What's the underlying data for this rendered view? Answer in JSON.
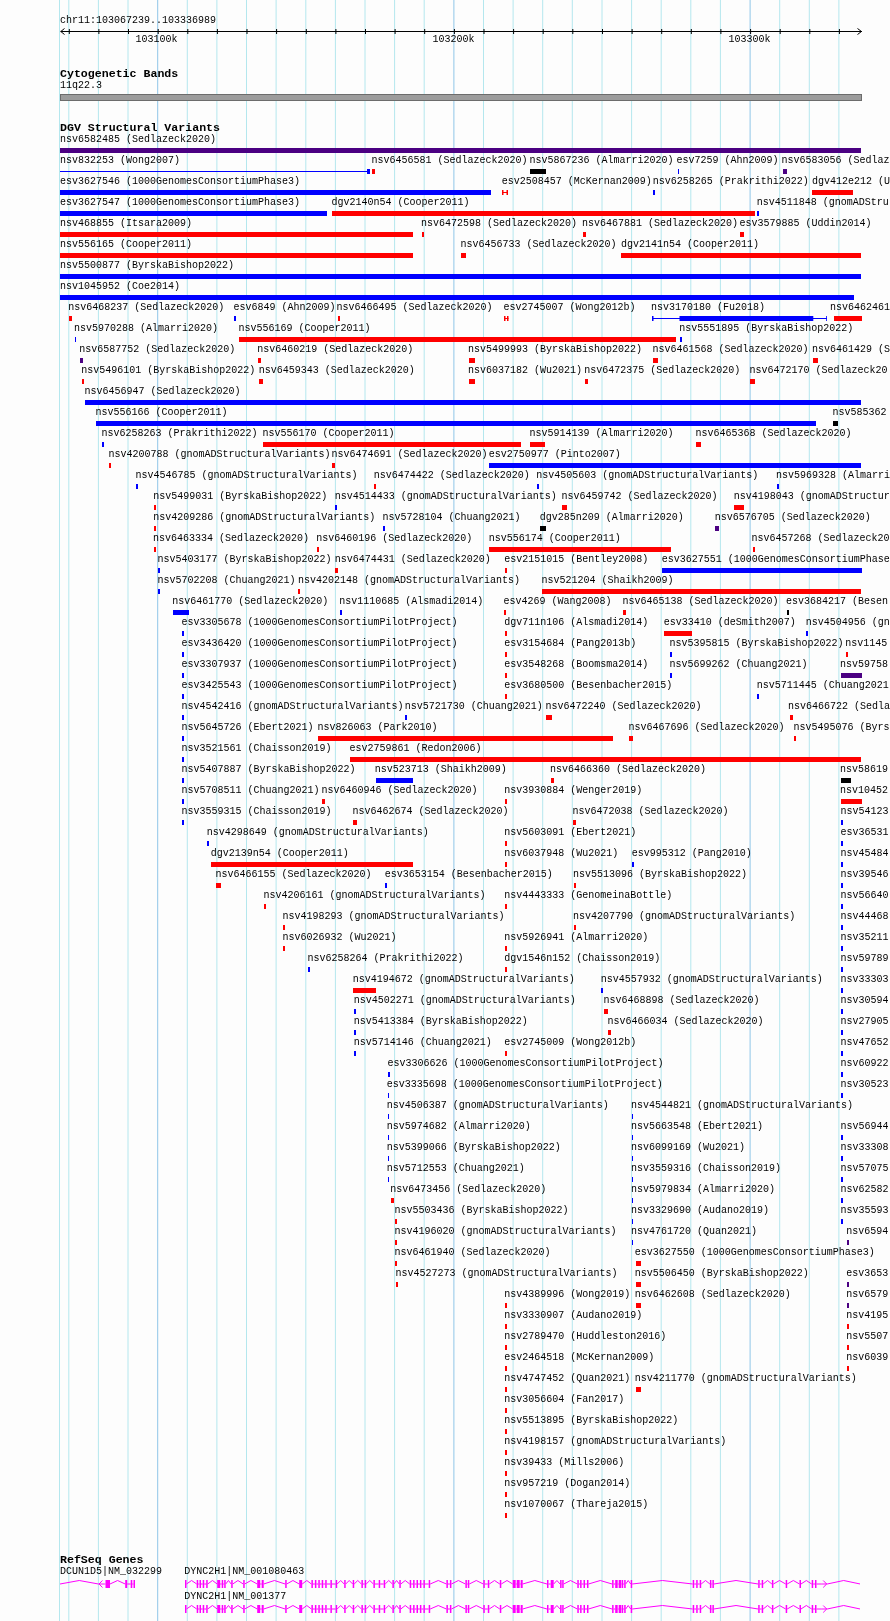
{
  "ruler": {
    "location": "chr11:103067239..103336989",
    "ticks": [
      "103100k",
      "103200k",
      "103300k"
    ]
  },
  "tracks": [
    {
      "kind": "cytoband",
      "title": "Cytogenetic Bands",
      "band": "11q22.3"
    },
    {
      "kind": "variants",
      "title": "DGV Structural Variants",
      "rows": [
        {
          "features": [
            {
              "label": "nsv6582485 (Sedlazeck2020)",
              "color": "#4b0082"
            }
          ]
        },
        {
          "features": [
            {
              "label": "nsv832253 (Wong2007)",
              "color": "#0000ff"
            },
            {
              "label": "nsv6456581 (Sedlazeck2020)",
              "color": "#ff0000"
            },
            {
              "label": "nsv5867236 (Almarri2020)",
              "color": "#000000"
            },
            {
              "label": "esv7259 (Ahn2009)",
              "color": "#0000ff"
            },
            {
              "label": "nsv6583056 (Sedlaz",
              "color": "#4b0082"
            }
          ]
        },
        {
          "features": [
            {
              "label": "esv3627546 (1000GenomesConsortiumPhase3)",
              "color": "#0000ff"
            },
            {
              "label": "esv2508457 (McKernan2009)",
              "color": "#ff0000"
            },
            {
              "label": "nsv6258265 (Prakrithi2022)",
              "color": "#0000ff"
            },
            {
              "label": "dgv412e212 (U",
              "color": "#ff0000"
            }
          ]
        },
        {
          "features": [
            {
              "label": "esv3627547 (1000GenomesConsortiumPhase3)",
              "color": "#0000ff"
            },
            {
              "label": "dgv2140n54 (Cooper2011)",
              "color": "#ff0000"
            },
            {
              "label": "nsv4511848 (gnomADStru",
              "color": "#0000ff"
            }
          ]
        },
        {
          "features": [
            {
              "label": "nsv468855 (Itsara2009)",
              "color": "#ff0000"
            },
            {
              "label": "nsv6472598 (Sedlazeck2020)",
              "color": "#ff0000"
            },
            {
              "label": "nsv6467881 (Sedlazeck2020)",
              "color": "#ff0000"
            },
            {
              "label": "esv3579885 (Uddin2014)",
              "color": "#ff0000"
            }
          ]
        },
        {
          "features": [
            {
              "label": "nsv556165 (Cooper2011)",
              "color": "#ff0000"
            },
            {
              "label": "nsv6456733 (Sedlazeck2020)",
              "color": "#ff0000"
            },
            {
              "label": "dgv2141n54 (Cooper2011)",
              "color": "#ff0000"
            }
          ]
        },
        {
          "features": [
            {
              "label": "nsv5500877 (ByrskaBishop2022)",
              "color": "#0000ff"
            }
          ]
        },
        {
          "features": [
            {
              "label": "nsv1045952 (Coe2014)",
              "color": "#0000ff"
            }
          ]
        },
        {
          "features": [
            {
              "label": "nsv6468237 (Sedlazeck2020)",
              "color": "#ff0000"
            },
            {
              "label": "esv6849 (Ahn2009)",
              "color": "#0000ff"
            },
            {
              "label": "nsv6466495 (Sedlazeck2020)",
              "color": "#ff0000"
            },
            {
              "label": "esv2745007 (Wong2012b)",
              "color": "#ff0000"
            },
            {
              "label": "nsv3170180 (Fu2018)",
              "color": "#0000ff"
            },
            {
              "label": "nsv6462461",
              "color": "#ff0000"
            }
          ]
        },
        {
          "features": [
            {
              "label": "nsv5970288 (Almarri2020)",
              "color": "#0000ff"
            },
            {
              "label": "nsv556169 (Cooper2011)",
              "color": "#ff0000"
            },
            {
              "label": "nsv5551895 (ByrskaBishop2022)",
              "color": "#0000ff"
            }
          ]
        },
        {
          "features": [
            {
              "label": "nsv6587752 (Sedlazeck2020)",
              "color": "#4b0082"
            },
            {
              "label": "nsv6460219 (Sedlazeck2020)",
              "color": "#ff0000"
            },
            {
              "label": "nsv5499993 (ByrskaBishop2022)",
              "color": "#ff0000"
            },
            {
              "label": "nsv6461568 (Sedlazeck2020)",
              "color": "#ff0000"
            },
            {
              "label": "nsv6461429 (S",
              "color": "#ff0000"
            }
          ]
        },
        {
          "features": [
            {
              "label": "nsv5496101 (ByrskaBishop2022)",
              "color": "#ff0000"
            },
            {
              "label": "nsv6459343 (Sedlazeck2020)",
              "color": "#ff0000"
            },
            {
              "label": "nsv6037182 (Wu2021)",
              "color": "#ff0000"
            },
            {
              "label": "nsv6472375 (Sedlazeck2020)",
              "color": "#ff0000"
            },
            {
              "label": "nsv6472170 (Sedlazeck20",
              "color": "#ff0000"
            }
          ]
        },
        {
          "features": [
            {
              "label": "nsv6456947 (Sedlazeck2020)",
              "color": "#0000ff"
            }
          ]
        },
        {
          "features": [
            {
              "label": "nsv556166 (Cooper2011)",
              "color": "#0000ff"
            },
            {
              "label": "nsv585362",
              "color": "#000000"
            }
          ]
        },
        {
          "features": [
            {
              "label": "nsv6258263 (Prakrithi2022)",
              "color": "#0000ff"
            },
            {
              "label": "nsv556170 (Cooper2011)",
              "color": "#ff0000"
            },
            {
              "label": "nsv5914139 (Almarri2020)",
              "color": "#ff0000"
            },
            {
              "label": "nsv6465368 (Sedlazeck2020)",
              "color": "#ff0000"
            }
          ]
        },
        {
          "features": [
            {
              "label": "nsv4200788 (gnomADStructuralVariants)",
              "color": "#ff0000"
            },
            {
              "label": "nsv6474691 (Sedlazeck2020)",
              "color": "#ff0000"
            },
            {
              "label": "esv2750977 (Pinto2007)",
              "color": "#0000ff"
            }
          ]
        },
        {
          "features": [
            {
              "label": "nsv4546785 (gnomADStructuralVariants)",
              "color": "#0000ff"
            },
            {
              "label": "nsv6474422 (Sedlazeck2020)",
              "color": "#ff0000"
            },
            {
              "label": "nsv4505603 (gnomADStructuralVariants)",
              "color": "#0000ff"
            },
            {
              "label": "nsv5969328 (Almarri",
              "color": "#0000ff"
            }
          ]
        },
        {
          "features": [
            {
              "label": "nsv5499031 (ByrskaBishop2022)",
              "color": "#ff0000"
            },
            {
              "label": "nsv4514433 (gnomADStructuralVariants)",
              "color": "#0000ff"
            },
            {
              "label": "nsv6459742 (Sedlazeck2020)",
              "color": "#ff0000"
            },
            {
              "label": "nsv4198043 (gnomADStructur",
              "color": "#ff0000"
            }
          ]
        },
        {
          "features": [
            {
              "label": "nsv4209286 (gnomADStructuralVariants)",
              "color": "#ff0000"
            },
            {
              "label": "nsv5728104 (Chuang2021)",
              "color": "#0000ff"
            },
            {
              "label": "dgv285n209 (Almarri2020)",
              "color": "#000000"
            },
            {
              "label": "nsv6576705 (Sedlazeck2020)",
              "color": "#4b0082"
            }
          ]
        },
        {
          "features": [
            {
              "label": "nsv6463334 (Sedlazeck2020)",
              "color": "#ff0000"
            },
            {
              "label": "nsv6460196 (Sedlazeck2020)",
              "color": "#ff0000"
            },
            {
              "label": "nsv556174 (Cooper2011)",
              "color": "#ff0000"
            },
            {
              "label": "nsv6457268 (Sedlazeck20",
              "color": "#ff0000"
            }
          ]
        },
        {
          "features": [
            {
              "label": "nsv5403177 (ByrskaBishop2022)",
              "color": "#0000ff"
            },
            {
              "label": "nsv6474431 (Sedlazeck2020)",
              "color": "#ff0000"
            },
            {
              "label": "esv2151015 (Bentley2008)",
              "color": "#ff0000"
            },
            {
              "label": "esv3627551 (1000GenomesConsortiumPhase",
              "color": "#0000ff"
            }
          ]
        },
        {
          "features": [
            {
              "label": "nsv5702208 (Chuang2021)",
              "color": "#0000ff"
            },
            {
              "label": "nsv4202148 (gnomADStructuralVariants)",
              "color": "#ff0000"
            },
            {
              "label": "nsv521204 (Shaikh2009)",
              "color": "#ff0000"
            }
          ]
        },
        {
          "features": [
            {
              "label": "nsv6461770 (Sedlazeck2020)",
              "color": "#0000ff"
            },
            {
              "label": "nsv1110685 (Alsmadi2014)",
              "color": "#0000ff"
            },
            {
              "label": "esv4269 (Wang2008)",
              "color": "#ff0000"
            },
            {
              "label": "nsv6465138 (Sedlazeck2020)",
              "color": "#ff0000"
            },
            {
              "label": "esv3684217 (Besen",
              "color": "#000000"
            }
          ]
        },
        {
          "features": [
            {
              "label": "esv3305678 (1000GenomesConsortiumPilotProject)",
              "color": "#0000ff"
            },
            {
              "label": "dgv711n106 (Alsmadi2014)",
              "color": "#ff0000"
            },
            {
              "label": "esv33410 (deSmith2007)",
              "color": "#ff0000"
            },
            {
              "label": "nsv4504956 (gn",
              "color": "#0000ff"
            }
          ]
        },
        {
          "features": [
            {
              "label": "esv3436420 (1000GenomesConsortiumPilotProject)",
              "color": "#0000ff"
            },
            {
              "label": "esv3154684 (Pang2013b)",
              "color": "#ff0000"
            },
            {
              "label": "nsv5395815 (ByrskaBishop2022)",
              "color": "#0000ff"
            },
            {
              "label": "nsv1145",
              "color": "#ff0000"
            }
          ]
        },
        {
          "features": [
            {
              "label": "esv3307937 (1000GenomesConsortiumPilotProject)",
              "color": "#0000ff"
            },
            {
              "label": "esv3548268 (Boomsma2014)",
              "color": "#ff0000"
            },
            {
              "label": "nsv5699262 (Chuang2021)",
              "color": "#0000ff"
            },
            {
              "label": "nsv59758",
              "color": "#4b0082"
            }
          ]
        },
        {
          "features": [
            {
              "label": "esv3425543 (1000GenomesConsortiumPilotProject)",
              "color": "#0000ff"
            },
            {
              "label": "esv3680500 (Besenbacher2015)",
              "color": "#ff0000"
            },
            {
              "label": "nsv5711445 (Chuang2021",
              "color": "#0000ff"
            }
          ]
        },
        {
          "features": [
            {
              "label": "nsv4542416 (gnomADStructuralVariants)",
              "color": "#0000ff"
            },
            {
              "label": "nsv5721730 (Chuang2021)",
              "color": "#0000ff"
            },
            {
              "label": "nsv6472240 (Sedlazeck2020)",
              "color": "#ff0000"
            },
            {
              "label": "nsv6466722 (Sedla",
              "color": "#ff0000"
            }
          ]
        },
        {
          "features": [
            {
              "label": "nsv5645726 (Ebert2021)",
              "color": "#0000ff"
            },
            {
              "label": "nsv826063 (Park2010)",
              "color": "#ff0000"
            },
            {
              "label": "nsv6467696 (Sedlazeck2020)",
              "color": "#ff0000"
            },
            {
              "label": "nsv5495076 (Byrs",
              "color": "#ff0000"
            }
          ]
        },
        {
          "features": [
            {
              "label": "nsv3521561 (Chaisson2019)",
              "color": "#0000ff"
            },
            {
              "label": "esv2759861 (Redon2006)",
              "color": "#ff0000"
            }
          ]
        },
        {
          "features": [
            {
              "label": "nsv5407887 (ByrskaBishop2022)",
              "color": "#0000ff"
            },
            {
              "label": "nsv523713 (Shaikh2009)",
              "color": "#0000ff"
            },
            {
              "label": "nsv6466360 (Sedlazeck2020)",
              "color": "#ff0000"
            },
            {
              "label": "nsv58619",
              "color": "#000000"
            }
          ]
        },
        {
          "features": [
            {
              "label": "nsv5708511 (Chuang2021)",
              "color": "#0000ff"
            },
            {
              "label": "nsv6460946 (Sedlazeck2020)",
              "color": "#ff0000"
            },
            {
              "label": "nsv3930884 (Wenger2019)",
              "color": "#ff0000"
            },
            {
              "label": "nsv10452",
              "color": "#ff0000"
            }
          ]
        },
        {
          "features": [
            {
              "label": "nsv3559315 (Chaisson2019)",
              "color": "#0000ff"
            },
            {
              "label": "nsv6462674 (Sedlazeck2020)",
              "color": "#ff0000"
            },
            {
              "label": "nsv6472038 (Sedlazeck2020)",
              "color": "#ff0000"
            },
            {
              "label": "nsv54123",
              "color": "#0000ff"
            }
          ]
        },
        {
          "features": [
            {
              "label": "nsv4298649 (gnomADStructuralVariants)",
              "color": "#0000ff"
            },
            {
              "label": "nsv5603091 (Ebert2021)",
              "color": "#ff0000"
            },
            {
              "label": "esv36531",
              "color": "#0000ff"
            }
          ]
        },
        {
          "features": [
            {
              "label": "dgv2139n54 (Cooper2011)",
              "color": "#ff0000"
            },
            {
              "label": "nsv6037948 (Wu2021)",
              "color": "#ff0000"
            },
            {
              "label": "esv995312 (Pang2010)",
              "color": "#0000ff"
            },
            {
              "label": "nsv45484",
              "color": "#0000ff"
            }
          ]
        },
        {
          "features": [
            {
              "label": "nsv6466155 (Sedlazeck2020)",
              "color": "#ff0000"
            },
            {
              "label": "esv3653154 (Besenbacher2015)",
              "color": "#0000ff"
            },
            {
              "label": "nsv5513096 (ByrskaBishop2022)",
              "color": "#ff0000"
            },
            {
              "label": "nsv39546",
              "color": "#0000ff"
            }
          ]
        },
        {
          "features": [
            {
              "label": "nsv4206161 (gnomADStructuralVariants)",
              "color": "#ff0000"
            },
            {
              "label": "nsv4443333 (GenomeinaBottle)",
              "color": "#ff0000"
            },
            {
              "label": "nsv56640",
              "color": "#0000ff"
            }
          ]
        },
        {
          "features": [
            {
              "label": "nsv4198293 (gnomADStructuralVariants)",
              "color": "#ff0000"
            },
            {
              "label": "nsv4207790 (gnomADStructuralVariants)",
              "color": "#ff0000"
            },
            {
              "label": "nsv44468",
              "color": "#0000ff"
            }
          ]
        },
        {
          "features": [
            {
              "label": "nsv6026932 (Wu2021)",
              "color": "#ff0000"
            },
            {
              "label": "nsv5926941 (Almarri2020)",
              "color": "#ff0000"
            },
            {
              "label": "nsv35211",
              "color": "#0000ff"
            }
          ]
        },
        {
          "features": [
            {
              "label": "nsv6258264 (Prakrithi2022)",
              "color": "#0000ff"
            },
            {
              "label": "dgv1546n152 (Chaisson2019)",
              "color": "#ff0000"
            },
            {
              "label": "nsv59789",
              "color": "#0000ff"
            }
          ]
        },
        {
          "features": [
            {
              "label": "nsv4194672 (gnomADStructuralVariants)",
              "color": "#ff0000"
            },
            {
              "label": "nsv4557932 (gnomADStructuralVariants)",
              "color": "#0000ff"
            },
            {
              "label": "nsv33303",
              "color": "#0000ff"
            }
          ]
        },
        {
          "features": [
            {
              "label": "nsv4502271 (gnomADStructuralVariants)",
              "color": "#0000ff"
            },
            {
              "label": "nsv6468898 (Sedlazeck2020)",
              "color": "#ff0000"
            },
            {
              "label": "nsv30594",
              "color": "#0000ff"
            }
          ]
        },
        {
          "features": [
            {
              "label": "nsv5413384 (ByrskaBishop2022)",
              "color": "#0000ff"
            },
            {
              "label": "nsv6466034 (Sedlazeck2020)",
              "color": "#ff0000"
            },
            {
              "label": "nsv27905",
              "color": "#0000ff"
            }
          ]
        },
        {
          "features": [
            {
              "label": "nsv5714146 (Chuang2021)",
              "color": "#0000ff"
            },
            {
              "label": "esv2745009 (Wong2012b)",
              "color": "#ff0000"
            },
            {
              "label": "nsv47652",
              "color": "#0000ff"
            }
          ]
        },
        {
          "features": [
            {
              "label": "esv3306626 (1000GenomesConsortiumPilotProject)",
              "color": "#0000ff"
            },
            {
              "label": "nsv60922",
              "color": "#0000ff"
            }
          ]
        },
        {
          "features": [
            {
              "label": "esv3335698 (1000GenomesConsortiumPilotProject)",
              "color": "#0000ff"
            },
            {
              "label": "nsv30523",
              "color": "#0000ff"
            }
          ]
        },
        {
          "features": [
            {
              "label": "nsv4506387 (gnomADStructuralVariants)",
              "color": "#0000ff"
            },
            {
              "label": "nsv4544821 (gnomADStructuralVariants)",
              "color": "#0000ff"
            }
          ]
        },
        {
          "features": [
            {
              "label": "nsv5974682 (Almarri2020)",
              "color": "#0000ff"
            },
            {
              "label": "nsv5663548 (Ebert2021)",
              "color": "#0000ff"
            },
            {
              "label": "nsv56944",
              "color": "#0000ff"
            }
          ]
        },
        {
          "features": [
            {
              "label": "nsv5399066 (ByrskaBishop2022)",
              "color": "#0000ff"
            },
            {
              "label": "nsv6099169 (Wu2021)",
              "color": "#0000ff"
            },
            {
              "label": "nsv33308",
              "color": "#0000ff"
            }
          ]
        },
        {
          "features": [
            {
              "label": "nsv5712553 (Chuang2021)",
              "color": "#0000ff"
            },
            {
              "label": "nsv3559316 (Chaisson2019)",
              "color": "#0000ff"
            },
            {
              "label": "nsv57075",
              "color": "#0000ff"
            }
          ]
        },
        {
          "features": [
            {
              "label": "nsv6473456 (Sedlazeck2020)",
              "color": "#ff0000"
            },
            {
              "label": "nsv5979834 (Almarri2020)",
              "color": "#0000ff"
            },
            {
              "label": "nsv62582",
              "color": "#0000ff"
            }
          ]
        },
        {
          "features": [
            {
              "label": "nsv5503436 (ByrskaBishop2022)",
              "color": "#ff0000"
            },
            {
              "label": "nsv3329690 (Audano2019)",
              "color": "#0000ff"
            },
            {
              "label": "nsv35593",
              "color": "#0000ff"
            }
          ]
        },
        {
          "features": [
            {
              "label": "nsv4196020 (gnomADStructuralVariants)",
              "color": "#ff0000"
            },
            {
              "label": "nsv4761720 (Quan2021)",
              "color": "#0000ff"
            },
            {
              "label": "nsv6594",
              "color": "#4b0082"
            }
          ]
        },
        {
          "features": [
            {
              "label": "nsv6461940 (Sedlazeck2020)",
              "color": "#ff0000"
            },
            {
              "label": "esv3627550 (1000GenomesConsortiumPhase3)",
              "color": "#ff0000"
            }
          ]
        },
        {
          "features": [
            {
              "label": "nsv4527273 (gnomADStructuralVariants)",
              "color": "#ff0000"
            },
            {
              "label": "nsv5506450 (ByrskaBishop2022)",
              "color": "#ff0000"
            },
            {
              "label": "esv3653",
              "color": "#4b0082"
            }
          ]
        },
        {
          "features": [
            {
              "label": "nsv4389996 (Wong2019)",
              "color": "#ff0000"
            },
            {
              "label": "nsv6462608 (Sedlazeck2020)",
              "color": "#ff0000"
            },
            {
              "label": "nsv6579",
              "color": "#4b0082"
            }
          ]
        },
        {
          "features": [
            {
              "label": "nsv3330907 (Audano2019)",
              "color": "#ff0000"
            },
            {
              "label": "nsv4195",
              "color": "#ff0000"
            }
          ]
        },
        {
          "features": [
            {
              "label": "nsv2789470 (Huddleston2016)",
              "color": "#ff0000"
            },
            {
              "label": "nsv5507",
              "color": "#ff0000"
            }
          ]
        },
        {
          "features": [
            {
              "label": "esv2464518 (McKernan2009)",
              "color": "#ff0000"
            },
            {
              "label": "nsv6039",
              "color": "#ff0000"
            }
          ]
        },
        {
          "features": [
            {
              "label": "nsv4747452 (Quan2021)",
              "color": "#ff0000"
            },
            {
              "label": "nsv4211770 (gnomADStructuralVariants)",
              "color": "#ff0000"
            }
          ]
        },
        {
          "features": [
            {
              "label": "nsv3056604 (Fan2017)",
              "color": "#ff0000"
            }
          ]
        },
        {
          "features": [
            {
              "label": "nsv5513895 (ByrskaBishop2022)",
              "color": "#ff0000"
            }
          ]
        },
        {
          "features": [
            {
              "label": "nsv4198157 (gnomADStructuralVariants)",
              "color": "#ff0000"
            }
          ]
        },
        {
          "features": [
            {
              "label": "nsv39433 (Mills2006)",
              "color": "#ff0000"
            }
          ]
        },
        {
          "features": [
            {
              "label": "nsv957219 (Dogan2014)",
              "color": "#ff0000"
            }
          ]
        },
        {
          "features": [
            {
              "label": "nsv1070067 (Thareja2015)",
              "color": "#ff0000"
            }
          ]
        }
      ]
    },
    {
      "kind": "genes",
      "title": "RefSeq Genes",
      "rows": [
        {
          "genes": [
            {
              "label": "DCUN1D5|NM_032299",
              "reverse": true
            },
            {
              "label": "DYNC2H1|NM_001080463",
              "reverse": false
            }
          ]
        },
        {
          "genes": [
            {
              "label": "DYNC2H1|NM_001377",
              "reverse": false
            }
          ]
        }
      ]
    }
  ]
}
